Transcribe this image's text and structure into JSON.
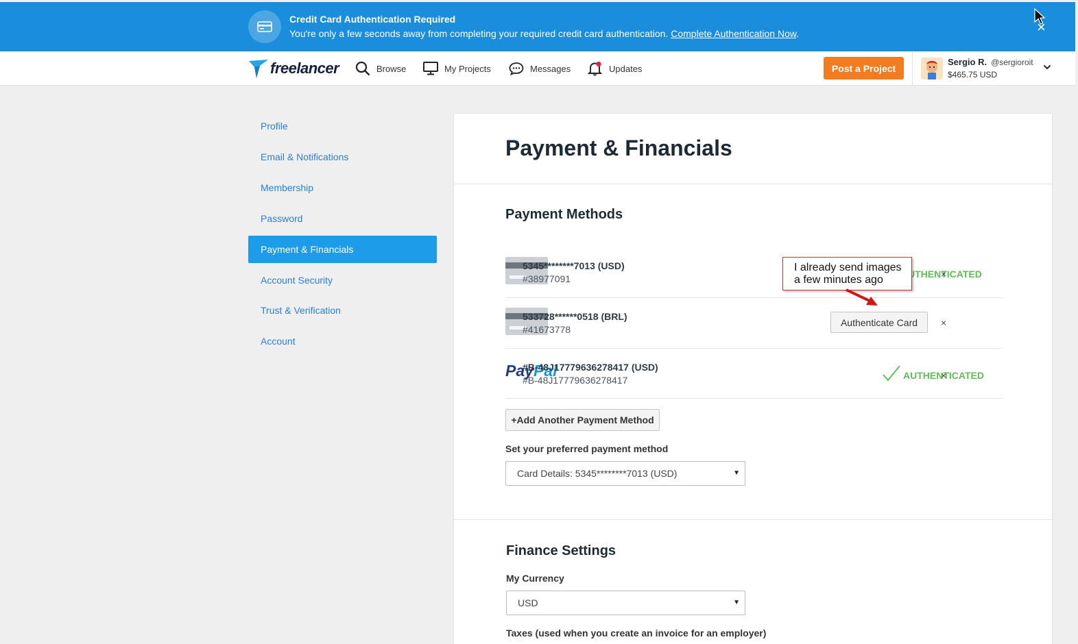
{
  "banner": {
    "icon": "credit-card-icon",
    "title": "Credit Card Authentication Required",
    "message": "You're only a few seconds away from completing your required credit card authentication.",
    "link": "Complete Authentication Now",
    "link_suffix": ".",
    "close": "×",
    "background_color": "#1a8ddc"
  },
  "nav": {
    "logo_text": "freelancer",
    "items": [
      {
        "label": "Browse",
        "icon": "search-icon"
      },
      {
        "label": "My Projects",
        "icon": "monitor-icon"
      },
      {
        "label": "Messages",
        "icon": "chat-bubble-icon"
      },
      {
        "label": "Updates",
        "icon": "bell-icon"
      }
    ],
    "post_button": "Post a Project",
    "post_button_color": "#f47c20",
    "user": {
      "name": "Sergio R.",
      "handle": "@sergioroit",
      "balance": "$465.75 USD"
    }
  },
  "sidebar": {
    "active_color": "#1d9ce9",
    "items": [
      {
        "label": "Profile",
        "active": false
      },
      {
        "label": "Email & Notifications",
        "active": false
      },
      {
        "label": "Membership",
        "active": false
      },
      {
        "label": "Password",
        "active": false
      },
      {
        "label": "Payment & Financials",
        "active": true
      },
      {
        "label": "Account Security",
        "active": false
      },
      {
        "label": "Trust & Verification",
        "active": false
      },
      {
        "label": "Account",
        "active": false
      }
    ]
  },
  "main": {
    "title": "Payment & Financials",
    "payment_methods": {
      "heading": "Payment Methods",
      "items": [
        {
          "type": "card",
          "title": "5345********7013 (USD)",
          "id": "#38977091",
          "status": "UTHENTICATED"
        },
        {
          "type": "card",
          "title": "533728******0518 (BRL)",
          "id": "#41673778",
          "action": "Authenticate Card"
        },
        {
          "type": "paypal",
          "logo": "PayPal",
          "title": "#B-48J17779636278417 (USD)",
          "id": "#B-48J17779636278417",
          "status": "AUTHENTICATED"
        }
      ],
      "remove": "×",
      "add_button": "+Add Another Payment Method",
      "preferred_label": "Set your preferred payment method",
      "preferred_value": "Card Details: 5345********7013 (USD)",
      "authenticated_color": "#5cbf54"
    },
    "finance_settings": {
      "heading": "Finance Settings",
      "currency_label": "My Currency",
      "currency_value": "USD",
      "taxes_label": "Taxes (used when you create an invoice for an employer)"
    }
  },
  "annotation": {
    "line1": "I already send images",
    "line2": "a few minutes ago"
  }
}
